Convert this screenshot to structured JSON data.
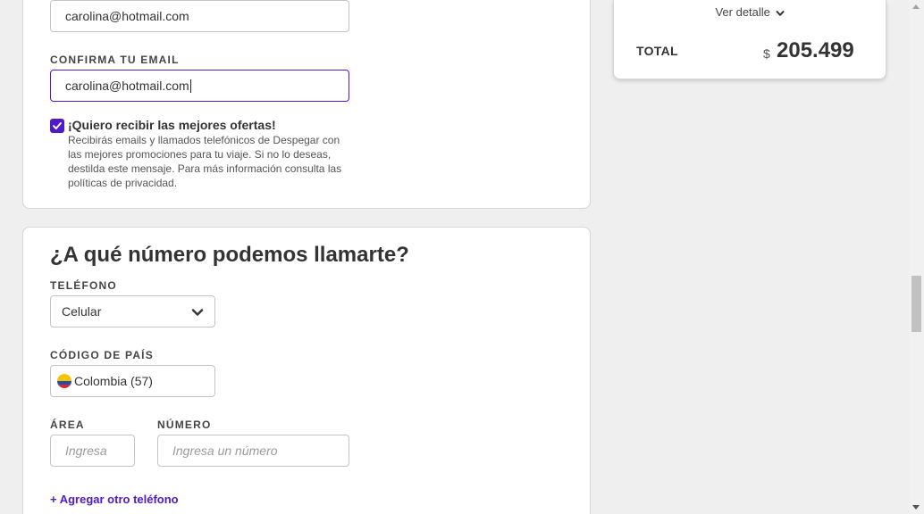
{
  "email_section": {
    "email_value": "carolina@hotmail.com",
    "confirm_label": "CONFIRMA TU EMAIL",
    "confirm_value": "carolina@hotmail.com",
    "offers_checked": true,
    "offers_title": "¡Quiero recibir las mejores ofertas!",
    "offers_text": "Recibirás emails y llamados telefónicos de Despegar con las mejores promociones para tu viaje. Si no lo deseas, destilda este mensaje. Para más información consulta las políticas de privacidad."
  },
  "phone_section": {
    "title": "¿A qué número podemos llamarte?",
    "phone_label": "TELÉFONO",
    "phone_type": "Celular",
    "country_label": "CÓDIGO DE PAÍS",
    "country_value": "Colombia (57)",
    "area_label": "ÁREA",
    "area_placeholder": "Ingresa",
    "number_label": "NÚMERO",
    "number_placeholder": "Ingresa un número",
    "add_phone_link": "+ Agregar otro teléfono"
  },
  "summary": {
    "detail_link": "Ver detalle",
    "total_label": "TOTAL",
    "currency": "$",
    "total_amount": "205.499"
  },
  "colors": {
    "accent": "#4d1bc9",
    "background": "#efefef"
  },
  "icons": [
    "check-icon",
    "chevron-down-icon",
    "colombia-flag-icon"
  ]
}
